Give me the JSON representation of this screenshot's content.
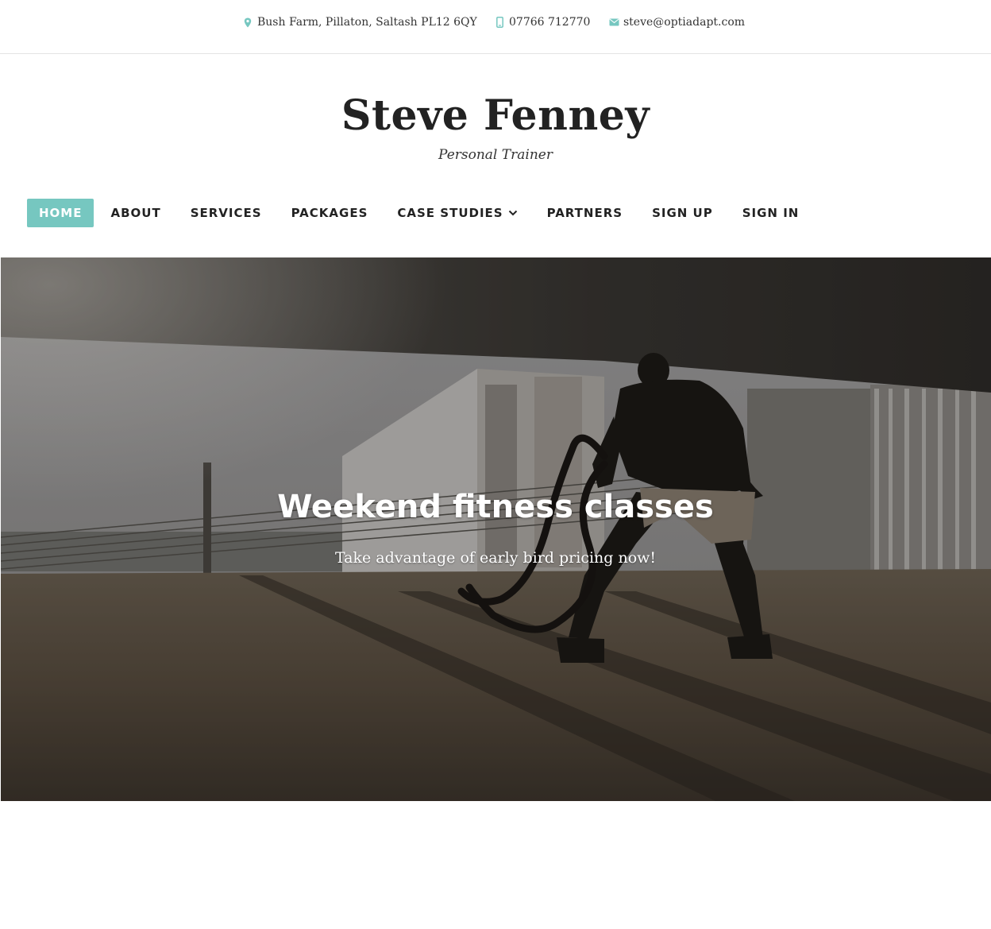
{
  "contact": {
    "address": "Bush Farm, Pillaton, Saltash PL12 6QY",
    "phone": "07766 712770",
    "email": "steve@optiadapt.com",
    "icons": [
      "map-pin-icon",
      "phone-icon",
      "envelope-icon"
    ],
    "icon_color": "#76c7c0"
  },
  "site": {
    "title": "Steve Fenney",
    "tagline": "Personal Trainer"
  },
  "nav": {
    "items": [
      {
        "label": "HOME",
        "active": true
      },
      {
        "label": "ABOUT"
      },
      {
        "label": "SERVICES"
      },
      {
        "label": "PACKAGES"
      },
      {
        "label": "CASE STUDIES",
        "has_dropdown": true
      },
      {
        "label": "PARTNERS"
      },
      {
        "label": "SIGN UP"
      },
      {
        "label": "SIGN IN"
      }
    ],
    "active_color": "#76c7c0"
  },
  "hero": {
    "heading": "Weekend fitness classes",
    "subheading": "Take advantage of early bird pricing now!"
  }
}
